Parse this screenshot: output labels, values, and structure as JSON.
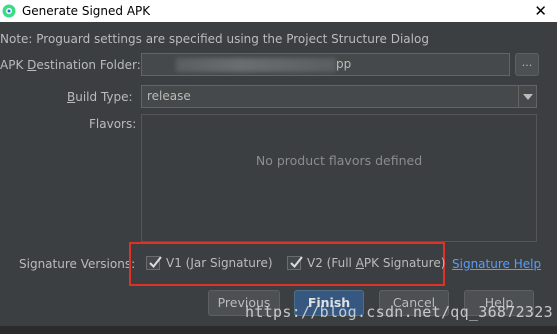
{
  "window": {
    "title": "Generate Signed APK",
    "close_glyph": "✕",
    "icon": "android-studio-icon"
  },
  "note": "Note: Proguard settings are specified using the Project Structure Dialog",
  "destination": {
    "label_pre": "APK ",
    "label_mnemonic": "D",
    "label_post": "estination Folder:",
    "value_visible": "pp",
    "browse_label": "..."
  },
  "build_type": {
    "label_mnemonic": "B",
    "label_post": "uild Type:",
    "value": "release"
  },
  "flavors": {
    "label": "Flavors:",
    "empty_text": "No product flavors defined"
  },
  "signature": {
    "label": "Signature Versions:",
    "v1": {
      "pre": "V1 (",
      "mnemonic": "J",
      "post": "ar Signature)",
      "checked": true
    },
    "v2": {
      "pre": "V2 (Full ",
      "mnemonic": "A",
      "post": "PK Signature)",
      "checked": true
    },
    "help_link": "Signature Help"
  },
  "buttons": {
    "previous": "Previous",
    "finish": "Finish",
    "cancel": "Cancel",
    "help": "Help"
  },
  "watermark": "https://blog.csdn.net/qq_36872323",
  "colors": {
    "background": "#3c3f41",
    "highlight_border": "#e0302a",
    "link": "#589df6",
    "primary_button": "#365880"
  }
}
